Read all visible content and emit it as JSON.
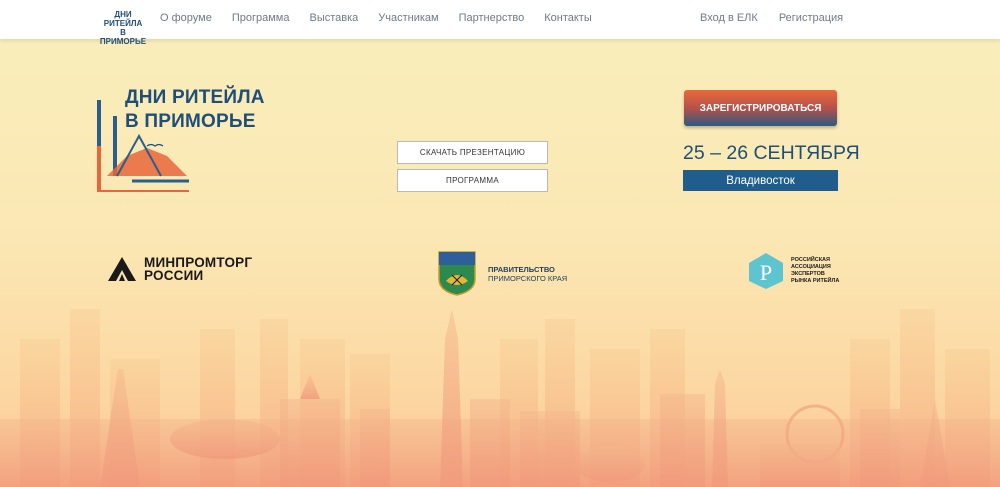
{
  "nav": {
    "logo_line1": "ДНИ РИТЕЙЛА",
    "logo_line2": "В ПРИМОРЬЕ",
    "links": [
      "О форуме",
      "Программа",
      "Выставка",
      "Участникам",
      "Партнерство",
      "Контакты"
    ],
    "login": "Вход в ЕЛК",
    "register": "Регистрация"
  },
  "hero": {
    "title_line1": "ДНИ РИТЕЙЛА",
    "title_line2": "В ПРИМОРЬЕ",
    "download_button": "СКАЧАТЬ ПРЕЗЕНТАЦИЮ",
    "program_button": "ПРОГРАММА",
    "register_button": "ЗАРЕГИСТРИРОВАТЬСЯ",
    "dates": "25 – 26 СЕНТЯБРЯ",
    "city": "Владивосток"
  },
  "partners": {
    "minprom_line1": "МИНПРОМТОРГ",
    "minprom_line2": "РОССИИ",
    "gov_line1": "ПРАВИТЕЛЬСТВО",
    "gov_line2": "ПРИМОРСКОГО КРАЯ",
    "rae_line1": "РОССИЙСКАЯ",
    "rae_line2": "АССОЦИАЦИЯ",
    "rae_line3": "ЭКСПЕРТОВ",
    "rae_line4": "РЫНКА РИТЕЙЛА"
  },
  "colors": {
    "brand_blue": "#1e4f79",
    "accent_orange": "#e86a3a",
    "city_bar": "#1f5e8c"
  }
}
